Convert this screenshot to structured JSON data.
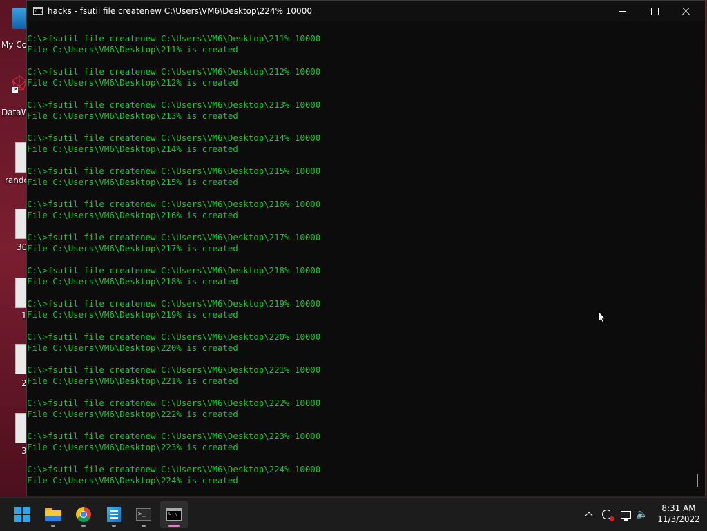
{
  "desktop": {
    "icons": [
      {
        "label": "My Co"
      },
      {
        "label": "DataW"
      },
      {
        "label": "rando"
      },
      {
        "label": "30"
      },
      {
        "label": "1"
      },
      {
        "label": "2"
      },
      {
        "label": "3"
      }
    ]
  },
  "window": {
    "title": "hacks - fsutil  file createnew C:\\Users\\VM6\\Desktop\\224% 10000",
    "icon_text": "C:\\",
    "buttons": {
      "minimize": "minimize-icon",
      "maximize": "maximize-icon",
      "close": "close-icon"
    }
  },
  "console": {
    "text_color": "#13c832",
    "lines": [
      "C:\\>fsutil file createnew C:\\Users\\VM6\\Desktop\\211% 10000",
      "File C:\\Users\\VM6\\Desktop\\211% is created",
      "",
      "C:\\>fsutil file createnew C:\\Users\\VM6\\Desktop\\212% 10000",
      "File C:\\Users\\VM6\\Desktop\\212% is created",
      "",
      "C:\\>fsutil file createnew C:\\Users\\VM6\\Desktop\\213% 10000",
      "File C:\\Users\\VM6\\Desktop\\213% is created",
      "",
      "C:\\>fsutil file createnew C:\\Users\\VM6\\Desktop\\214% 10000",
      "File C:\\Users\\VM6\\Desktop\\214% is created",
      "",
      "C:\\>fsutil file createnew C:\\Users\\VM6\\Desktop\\215% 10000",
      "File C:\\Users\\VM6\\Desktop\\215% is created",
      "",
      "C:\\>fsutil file createnew C:\\Users\\VM6\\Desktop\\216% 10000",
      "File C:\\Users\\VM6\\Desktop\\216% is created",
      "",
      "C:\\>fsutil file createnew C:\\Users\\VM6\\Desktop\\217% 10000",
      "File C:\\Users\\VM6\\Desktop\\217% is created",
      "",
      "C:\\>fsutil file createnew C:\\Users\\VM6\\Desktop\\218% 10000",
      "File C:\\Users\\VM6\\Desktop\\218% is created",
      "",
      "C:\\>fsutil file createnew C:\\Users\\VM6\\Desktop\\219% 10000",
      "File C:\\Users\\VM6\\Desktop\\219% is created",
      "",
      "C:\\>fsutil file createnew C:\\Users\\VM6\\Desktop\\220% 10000",
      "File C:\\Users\\VM6\\Desktop\\220% is created",
      "",
      "C:\\>fsutil file createnew C:\\Users\\VM6\\Desktop\\221% 10000",
      "File C:\\Users\\VM6\\Desktop\\221% is created",
      "",
      "C:\\>fsutil file createnew C:\\Users\\VM6\\Desktop\\222% 10000",
      "File C:\\Users\\VM6\\Desktop\\222% is created",
      "",
      "C:\\>fsutil file createnew C:\\Users\\VM6\\Desktop\\223% 10000",
      "File C:\\Users\\VM6\\Desktop\\223% is created",
      "",
      "C:\\>fsutil file createnew C:\\Users\\VM6\\Desktop\\224% 10000",
      "File C:\\Users\\VM6\\Desktop\\224% is created"
    ]
  },
  "taskbar": {
    "apps": [
      {
        "name": "start",
        "icon": "windows-logo-icon"
      },
      {
        "name": "file-explorer",
        "icon": "folder-icon"
      },
      {
        "name": "chrome",
        "icon": "chrome-icon"
      },
      {
        "name": "app",
        "icon": "app-icon"
      },
      {
        "name": "terminal",
        "icon": "terminal-icon",
        "icon_text": ">_"
      },
      {
        "name": "command-prompt",
        "icon": "cmd-icon",
        "icon_text": "C:\\",
        "active": true
      }
    ],
    "tray": {
      "chevron": "chevron-up-icon",
      "sync": "sync-icon",
      "network": "network-icon",
      "volume": "speaker-icon"
    },
    "clock": {
      "time": "8:31 AM",
      "date": "11/3/2022"
    }
  }
}
